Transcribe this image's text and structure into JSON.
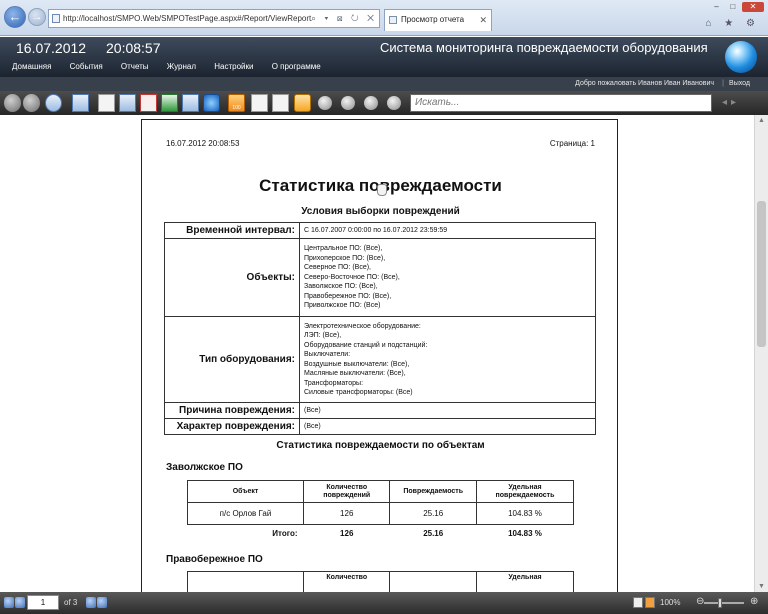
{
  "browser": {
    "url": "http://localhost/SMPO.Web/SMPOTestPage.aspx#/Report/ViewReport",
    "tab_title": "Просмотр отчета",
    "addr_tools": "⌕ ▾ ⊠ ↻ ✕",
    "chrome_icons": "⌂ ★ ⚙"
  },
  "header": {
    "date": "16.07.2012",
    "time": "20:08:57",
    "title": "Система мониторинга повреждаемости оборудования",
    "menu": [
      "Домашняя",
      "События",
      "Отчеты",
      "Журнал",
      "Настройки",
      "О программе"
    ]
  },
  "welcome": {
    "text": "Добро пожаловать Иванов Иван Иванович",
    "separator": "|",
    "logout": "Выход"
  },
  "toolbar": {
    "search_placeholder": "Искать...",
    "zoom_badge": "100"
  },
  "report": {
    "print_date": "16.07.2012 20:08:53",
    "page_label": "Страница: 1",
    "title": "Статистика повреждаемости",
    "conditions_title": "Условия выборки повреждений",
    "conditions": {
      "interval_label": "Временной интервал:",
      "interval_value": "С 16.07.2007 0:00:00 по 16.07.2012 23:59:59",
      "objects_label": "Объекты:",
      "objects": [
        "Центральное ПО: (Все),",
        "Прихоперское ПО: (Все),",
        "Северное ПО: (Все),",
        "Северо-Восточное ПО: (Все),",
        "Заволжское ПО: (Все),",
        "Правобережное ПО: (Все),",
        "Приволжское ПО: (Все)"
      ],
      "equipment_label": "Тип оборудования:",
      "equipment": [
        "Электротехническое оборудование:",
        "ЛЭП: (Все),",
        "Оборудование станций и подстанций:",
        "Выключатели:",
        "Воздушные выключатели: (Все),",
        "Масляные выключатели: (Все),",
        "Трансформаторы:",
        "Силовые трансформаторы: (Все)"
      ],
      "cause_label": "Причина повреждения:",
      "cause_value": "(Все)",
      "character_label": "Характер повреждения:",
      "character_value": "(Все)"
    },
    "stats_title": "Статистика повреждаемости по объектам",
    "columns": [
      "Объект",
      "Количество повреждений",
      "Повреждаемость",
      "Удельная повреждаемость"
    ],
    "columns_partial": [
      "",
      "Количество",
      "",
      "Удельная"
    ],
    "groups": [
      {
        "name": "Заволжское ПО",
        "rows": [
          {
            "object": "п/с Орлов Гай",
            "count": "126",
            "rate": "25.16",
            "specific": "104.83 %"
          }
        ],
        "total_label": "Итого:",
        "total": {
          "count": "126",
          "rate": "25.16",
          "specific": "104.83 %"
        }
      },
      {
        "name": "Правобережное ПО"
      }
    ]
  },
  "statusbar": {
    "page_value": "1",
    "page_of": "of 3",
    "zoom": "100%",
    "zoom_level": 0.4,
    "minus": "⊖",
    "plus": "⊕"
  }
}
